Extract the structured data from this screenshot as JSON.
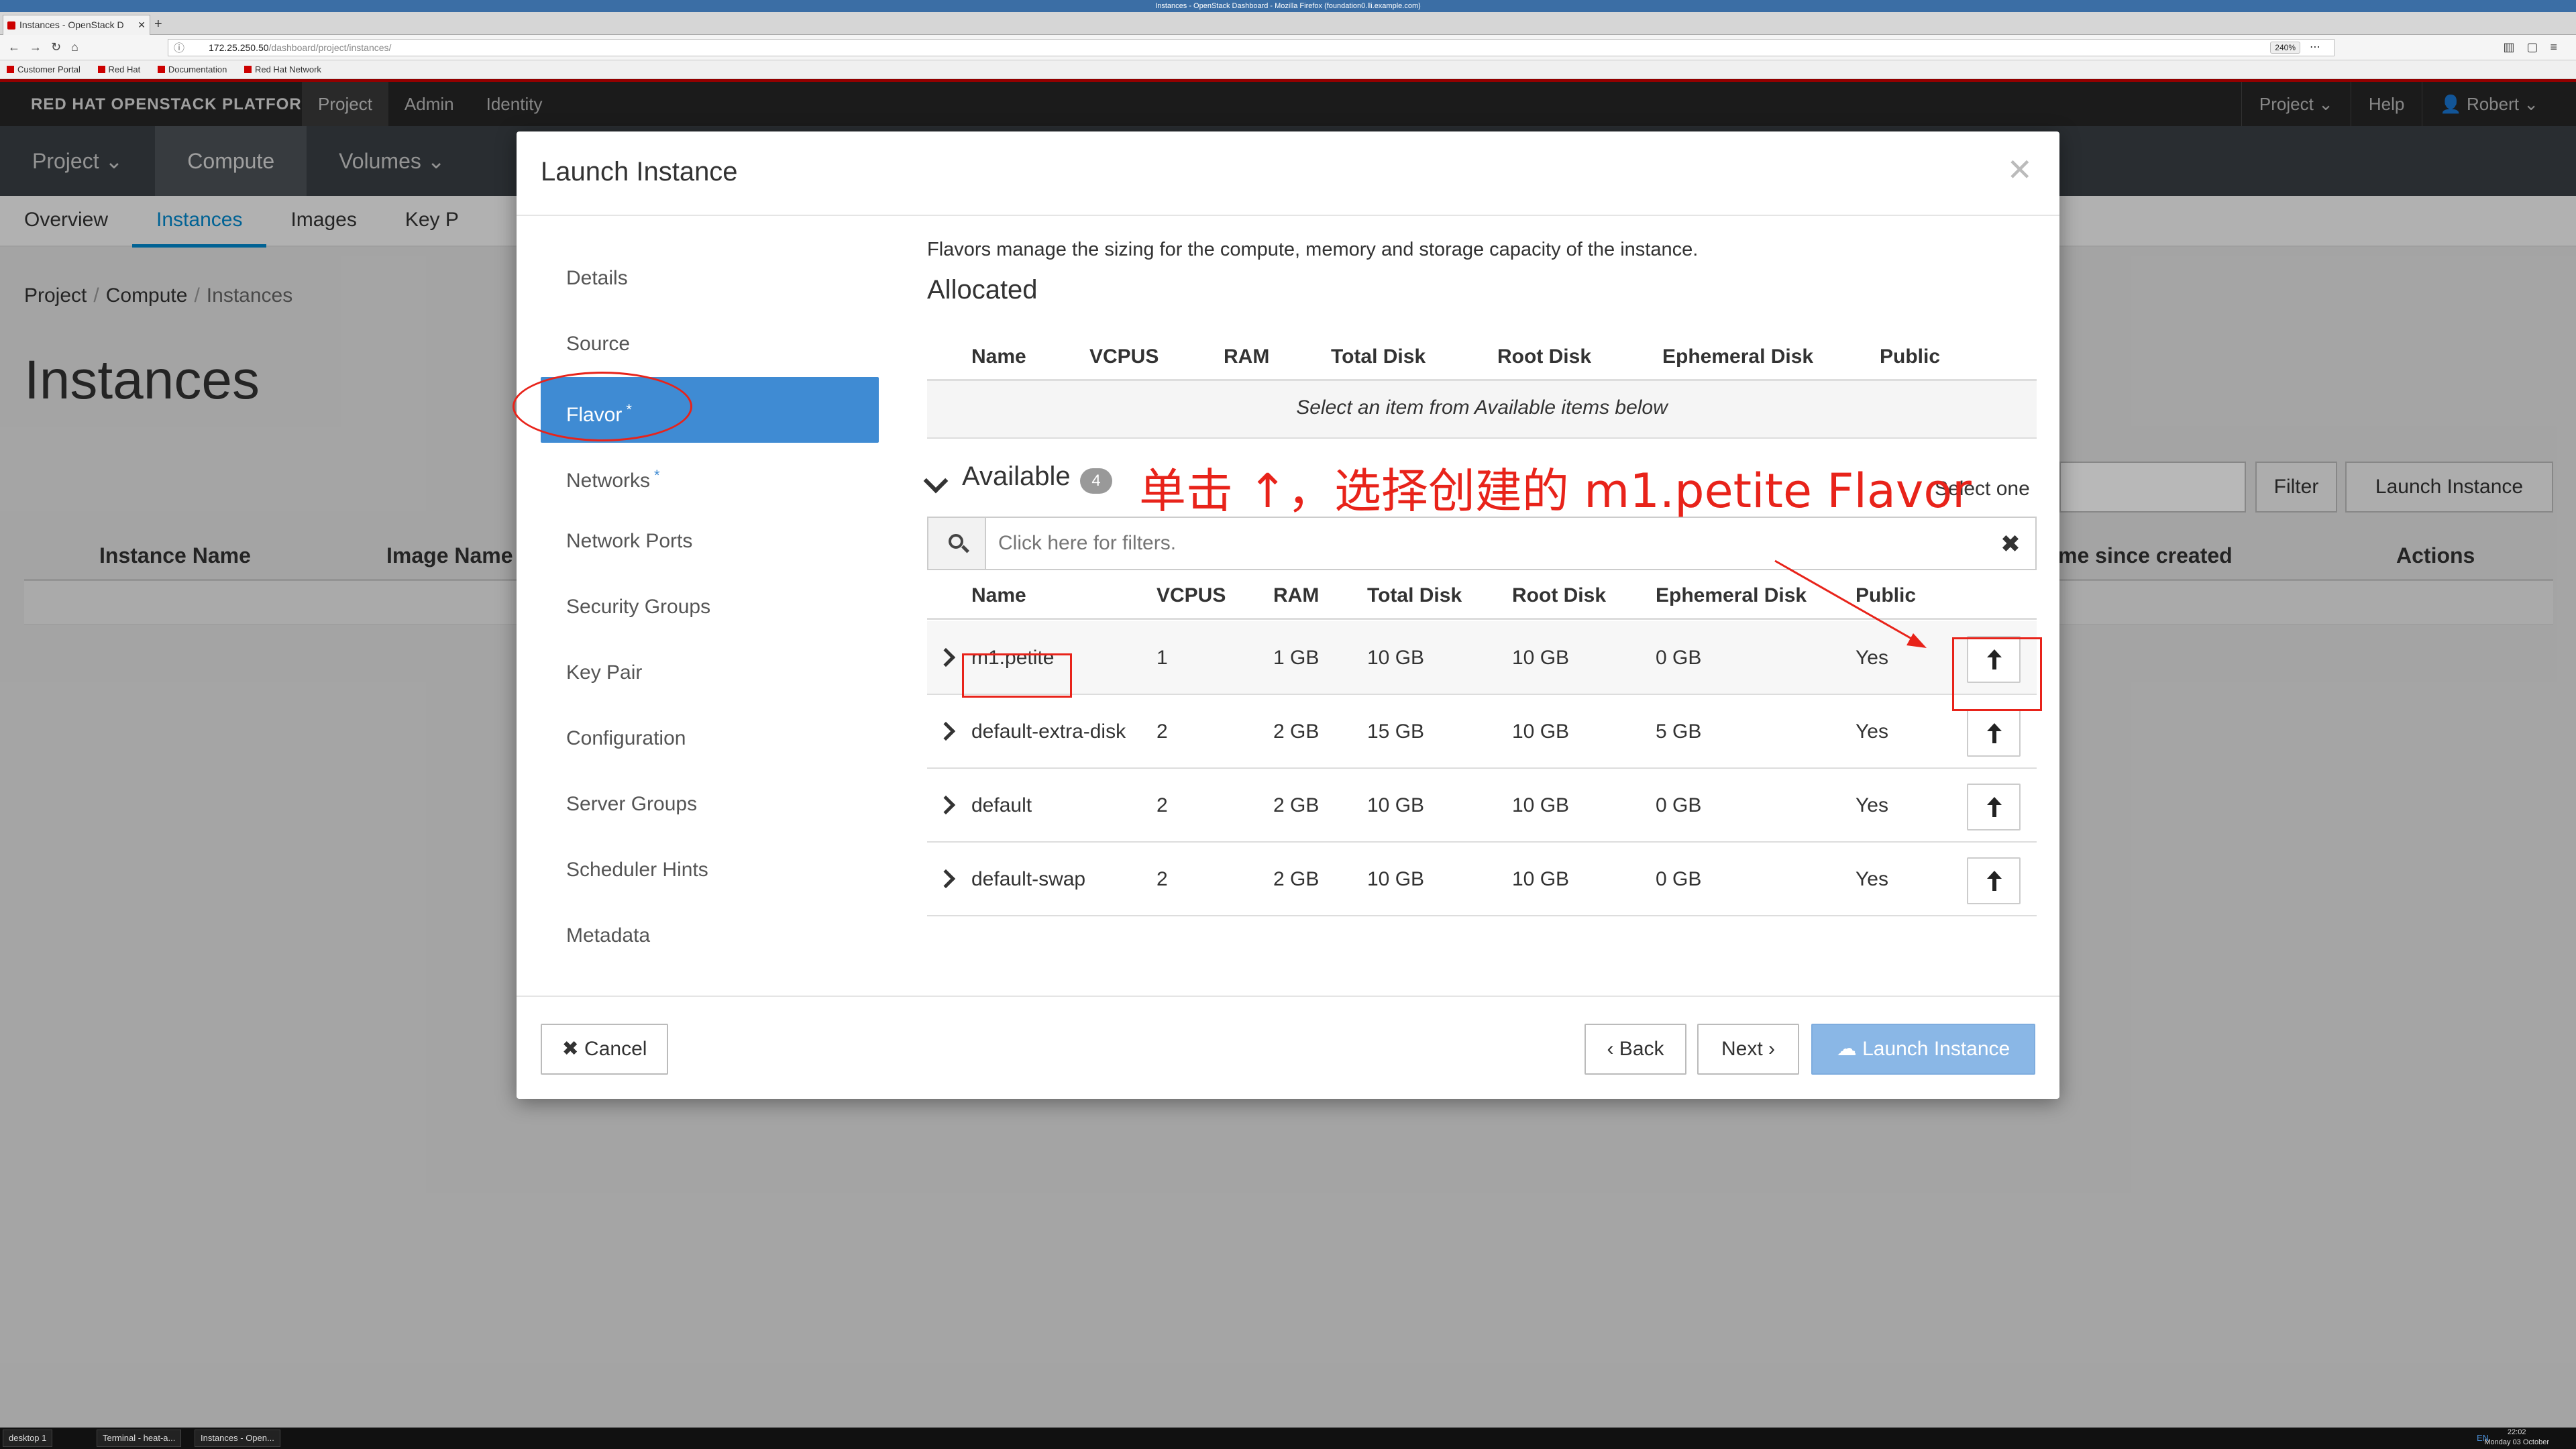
{
  "browser": {
    "window_title": "Instances - OpenStack Dashboard - Mozilla Firefox (foundation0.lli.example.com)",
    "tab_title": "Instances - OpenStack D",
    "url_host": "172.25.250.50",
    "url_path": "/dashboard/project/instances/",
    "zoom": "240%",
    "bookmarks": [
      "Customer Portal",
      "Red Hat",
      "Documentation",
      "Red Hat Network"
    ]
  },
  "header": {
    "brand": "RED HAT OPENSTACK PLATFORM",
    "nav": [
      "Project",
      "Admin",
      "Identity"
    ],
    "right": {
      "project": "Project ⌄",
      "help": "Help",
      "user": "👤 Robert ⌄"
    }
  },
  "subnav": [
    "Project ⌄",
    "Compute",
    "Volumes ⌄"
  ],
  "tabs": [
    "Overview",
    "Instances",
    "Images",
    "Key P"
  ],
  "breadcrumb": [
    "Project",
    "Compute",
    "Instances"
  ],
  "page": {
    "title": "Instances",
    "filter_btn": "Filter",
    "launch_btn": "Launch Instance",
    "columns": [
      "Instance Name",
      "Image Name",
      "me since created",
      "Actions"
    ]
  },
  "modal": {
    "title": "Launch Instance",
    "steps": [
      {
        "label": "Details",
        "required": ""
      },
      {
        "label": "Source",
        "required": ""
      },
      {
        "label": "Flavor",
        "required": "*"
      },
      {
        "label": "Networks",
        "required": "*"
      },
      {
        "label": "Network Ports",
        "required": ""
      },
      {
        "label": "Security Groups",
        "required": ""
      },
      {
        "label": "Key Pair",
        "required": ""
      },
      {
        "label": "Configuration",
        "required": ""
      },
      {
        "label": "Server Groups",
        "required": ""
      },
      {
        "label": "Scheduler Hints",
        "required": ""
      },
      {
        "label": "Metadata",
        "required": ""
      }
    ],
    "description": "Flavors manage the sizing for the compute, memory and storage capacity of the instance.",
    "allocated": {
      "title": "Allocated",
      "columns": [
        "Name",
        "VCPUS",
        "RAM",
        "Total Disk",
        "Root Disk",
        "Ephemeral Disk",
        "Public"
      ],
      "empty_text": "Select an item from Available items below"
    },
    "available": {
      "title": "Available",
      "count": "4",
      "select_hint": "Select one",
      "filter_placeholder": "Click here for filters.",
      "columns": [
        "Name",
        "VCPUS",
        "RAM",
        "Total Disk",
        "Root Disk",
        "Ephemeral Disk",
        "Public"
      ],
      "rows": [
        {
          "name": "m1.petite",
          "vcpus": "1",
          "ram": "1 GB",
          "total_disk": "10 GB",
          "root_disk": "10 GB",
          "ephemeral": "0 GB",
          "public": "Yes"
        },
        {
          "name": "default-extra-disk",
          "vcpus": "2",
          "ram": "2 GB",
          "total_disk": "15 GB",
          "root_disk": "10 GB",
          "ephemeral": "5 GB",
          "public": "Yes"
        },
        {
          "name": "default",
          "vcpus": "2",
          "ram": "2 GB",
          "total_disk": "10 GB",
          "root_disk": "10 GB",
          "ephemeral": "0 GB",
          "public": "Yes"
        },
        {
          "name": "default-swap",
          "vcpus": "2",
          "ram": "2 GB",
          "total_disk": "10 GB",
          "root_disk": "10 GB",
          "ephemeral": "0 GB",
          "public": "Yes"
        }
      ]
    },
    "footer": {
      "cancel": "✖ Cancel",
      "back": "‹ Back",
      "next": "Next ›",
      "launch": "☁ Launch Instance"
    }
  },
  "annotation": {
    "text": "单击 ↑，选择创建的 m1.petite Flavor",
    "color": "#e8231a"
  },
  "taskbar": {
    "items": [
      "desktop 1",
      "Terminal - heat-a...",
      "Instances - Open..."
    ],
    "time": "22:02",
    "date": "Monday 03 October",
    "lang": "EN"
  }
}
